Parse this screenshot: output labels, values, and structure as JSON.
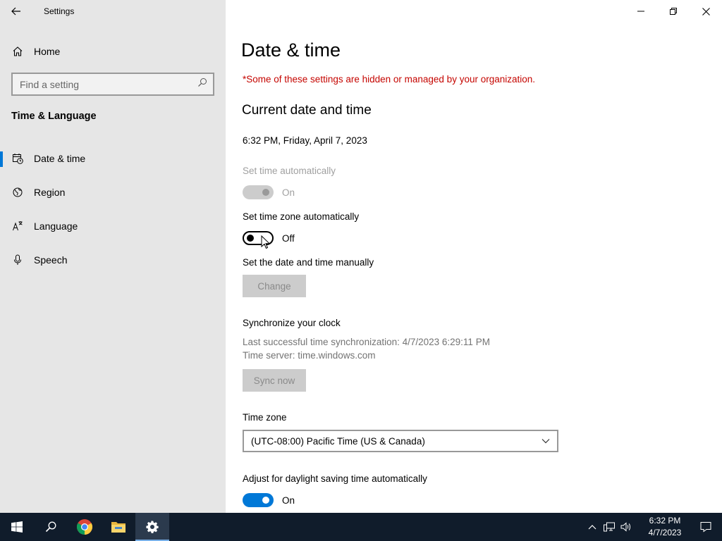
{
  "window": {
    "app_title": "Settings"
  },
  "sidebar": {
    "home_label": "Home",
    "search": {
      "placeholder": "Find a setting",
      "value": ""
    },
    "section_heading": "Time & Language",
    "items": [
      {
        "label": "Date & time",
        "icon": "date-time-icon",
        "active": true
      },
      {
        "label": "Region",
        "icon": "globe-icon",
        "active": false
      },
      {
        "label": "Language",
        "icon": "language-icon",
        "active": false
      },
      {
        "label": "Speech",
        "icon": "microphone-icon",
        "active": false
      }
    ]
  },
  "main": {
    "page_title": "Date & time",
    "org_note": "*Some of these settings are hidden or managed by your organization.",
    "current_heading": "Current date and time",
    "current_datetime": "6:32 PM, Friday, April 7, 2023",
    "set_time_auto": {
      "label": "Set time automatically",
      "state": "On",
      "enabled": false
    },
    "set_timezone_auto": {
      "label": "Set time zone automatically",
      "state": "Off",
      "enabled": true
    },
    "manual": {
      "label": "Set the date and time manually",
      "button": "Change"
    },
    "sync": {
      "heading": "Synchronize your clock",
      "last_sync": "Last successful time synchronization: 4/7/2023 6:29:11 PM",
      "server": "Time server: time.windows.com",
      "button": "Sync now"
    },
    "timezone": {
      "label": "Time zone",
      "value": "(UTC-08:00) Pacific Time (US & Canada)"
    },
    "dst": {
      "label": "Adjust for daylight saving time automatically",
      "state": "On"
    }
  },
  "taskbar": {
    "apps": [
      "start-icon",
      "search-icon",
      "chrome-icon",
      "file-explorer-icon",
      "settings-icon"
    ],
    "active_app": "settings-icon",
    "tray_icons": [
      "chevron-up-icon",
      "network-icon",
      "volume-icon"
    ],
    "time": "6:32 PM",
    "date": "4/7/2023"
  },
  "colors": {
    "accent": "#0078d7",
    "warning": "#c50500",
    "sidebar_bg": "#e6e6e6",
    "taskbar_bg": "#101c2b"
  }
}
